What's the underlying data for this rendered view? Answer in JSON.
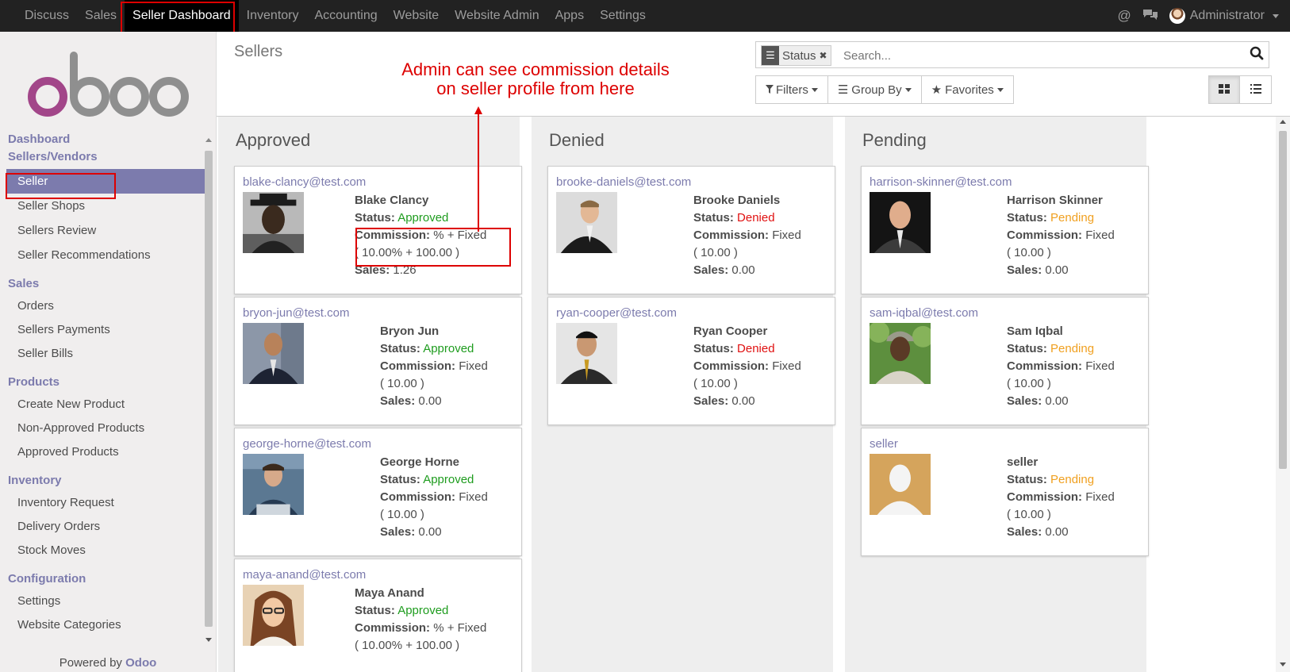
{
  "topbar": {
    "menu": [
      "Discuss",
      "Sales",
      "Seller Dashboard",
      "Inventory",
      "Accounting",
      "Website",
      "Website Admin",
      "Apps",
      "Settings"
    ],
    "active": "Seller Dashboard",
    "user": "Administrator"
  },
  "sidebar": {
    "logo_text": "odoo",
    "dashboard": "Dashboard",
    "sellers_vendors": "Sellers/Vendors",
    "seller_items": [
      "Seller",
      "Seller Shops",
      "Sellers Review",
      "Seller Recommendations"
    ],
    "sales_label": "Sales",
    "sales_items": [
      "Orders",
      "Sellers Payments",
      "Seller Bills"
    ],
    "products_label": "Products",
    "products_items": [
      "Create New Product",
      "Non-Approved Products",
      "Approved Products"
    ],
    "inventory_label": "Inventory",
    "inventory_items": [
      "Inventory Request",
      "Delivery Orders",
      "Stock Moves"
    ],
    "configuration_label": "Configuration",
    "configuration_items": [
      "Settings",
      "Website Categories"
    ],
    "powered_prefix": "Powered by",
    "powered_brand": "Odoo"
  },
  "control": {
    "title": "Sellers",
    "facet": "Status",
    "search_placeholder": "Search...",
    "filters": "Filters",
    "group_by": "Group By",
    "favorites": "Favorites"
  },
  "annotation": {
    "line1": "Admin can see commission details",
    "line2": "on seller profile from here"
  },
  "labels": {
    "status": "Status:",
    "commission": "Commission:",
    "sales": "Sales:"
  },
  "columns": [
    {
      "title": "Approved",
      "cards": [
        {
          "email": "blake-clancy@test.com",
          "name": "Blake Clancy",
          "status": "Approved",
          "commission": "% + Fixed",
          "commission_detail": "( 10.00% + 100.00 )",
          "sales": "1.26"
        },
        {
          "email": "bryon-jun@test.com",
          "name": "Bryon Jun",
          "status": "Approved",
          "commission": "Fixed",
          "commission_detail": "( 10.00 )",
          "sales": "0.00"
        },
        {
          "email": "george-horne@test.com",
          "name": "George Horne",
          "status": "Approved",
          "commission": "Fixed",
          "commission_detail": "( 10.00 )",
          "sales": "0.00"
        },
        {
          "email": "maya-anand@test.com",
          "name": "Maya Anand",
          "status": "Approved",
          "commission": "% + Fixed",
          "commission_detail": "( 10.00% + 100.00 )",
          "sales": ""
        }
      ]
    },
    {
      "title": "Denied",
      "cards": [
        {
          "email": "brooke-daniels@test.com",
          "name": "Brooke Daniels",
          "status": "Denied",
          "commission": "Fixed",
          "commission_detail": "( 10.00 )",
          "sales": "0.00"
        },
        {
          "email": "ryan-cooper@test.com",
          "name": "Ryan Cooper",
          "status": "Denied",
          "commission": "Fixed",
          "commission_detail": "( 10.00 )",
          "sales": "0.00"
        }
      ]
    },
    {
      "title": "Pending",
      "cards": [
        {
          "email": "harrison-skinner@test.com",
          "name": "Harrison Skinner",
          "status": "Pending",
          "commission": "Fixed",
          "commission_detail": "( 10.00 )",
          "sales": "0.00"
        },
        {
          "email": "sam-iqbal@test.com",
          "name": "Sam Iqbal",
          "status": "Pending",
          "commission": "Fixed",
          "commission_detail": "( 10.00 )",
          "sales": "0.00"
        },
        {
          "email": "seller",
          "name": "seller",
          "status": "Pending",
          "commission": "Fixed",
          "commission_detail": "( 10.00 )",
          "sales": "0.00"
        }
      ]
    }
  ],
  "colors": {
    "brand": "#7c7bad",
    "approved": "#1e9c1e",
    "denied": "#e01010",
    "pending": "#f0a020",
    "annotation": "#dd0000"
  }
}
